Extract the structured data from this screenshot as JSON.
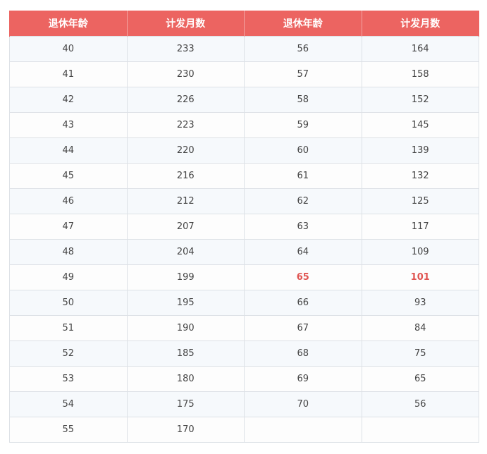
{
  "table": {
    "headers": [
      "退休年龄",
      "计发月数",
      "退休年龄",
      "计发月数"
    ],
    "rows": [
      [
        "40",
        "233",
        "56",
        "164"
      ],
      [
        "41",
        "230",
        "57",
        "158"
      ],
      [
        "42",
        "226",
        "58",
        "152"
      ],
      [
        "43",
        "223",
        "59",
        "145"
      ],
      [
        "44",
        "220",
        "60",
        "139"
      ],
      [
        "45",
        "216",
        "61",
        "132"
      ],
      [
        "46",
        "212",
        "62",
        "125"
      ],
      [
        "47",
        "207",
        "63",
        "117"
      ],
      [
        "48",
        "204",
        "64",
        "109"
      ],
      [
        "49",
        "199",
        "65",
        "101"
      ],
      [
        "50",
        "195",
        "66",
        "93"
      ],
      [
        "51",
        "190",
        "67",
        "84"
      ],
      [
        "52",
        "185",
        "68",
        "75"
      ],
      [
        "53",
        "180",
        "69",
        "65"
      ],
      [
        "54",
        "175",
        "70",
        "56"
      ],
      [
        "55",
        "170",
        "",
        ""
      ]
    ],
    "highlight_row": 9,
    "highlight_cols": [
      2,
      3
    ],
    "colors": {
      "header_bg": "#ec6461",
      "header_text": "#ffffff",
      "highlight_text": "#e05552",
      "row_odd_bg": "#f6f9fc",
      "row_even_bg": "#fdfdfd",
      "border": "#dde1e6"
    }
  }
}
